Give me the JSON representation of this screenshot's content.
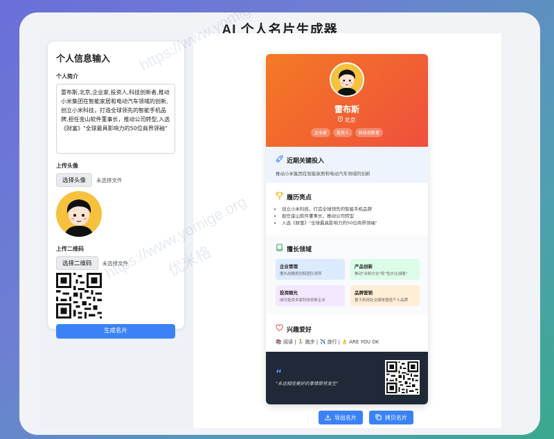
{
  "app": {
    "title": "AI 个人名片生成器"
  },
  "form": {
    "title": "个人信息输入",
    "bio_label": "个人简介",
    "bio_value": "雷布斯,北京,企业家,投资人,科技创新者,推动小米集团在智能家居和电动汽车领域的创新,创立小米科技，打造全球领先的智能手机品牌,担任金山软件董事长，推动公司转型,入选《财富》\"全球最具影响力的50位商界领袖\"",
    "avatar_label": "上传头像",
    "avatar_button": "选择头像",
    "avatar_status": "未选择文件",
    "qr_label": "上传二维码",
    "qr_button": "选择二维码",
    "qr_status": "未选择文件",
    "generate_button": "生成名片"
  },
  "card": {
    "name": "雷布斯",
    "location": "北京",
    "tags": [
      "企业家",
      "投资人",
      "科技创新者"
    ],
    "focus": {
      "title": "近期关键投入",
      "text": "推动小米集团在智能家居和电动汽车领域的创新"
    },
    "highlights": {
      "title": "履历亮点",
      "items": [
        "创立小米科技，打造全球领先的智能手机品牌",
        "担任金山软件董事长，推动公司转型",
        "入选《财富》\"全球最具影响力的50位商界领袖\""
      ]
    },
    "skills": {
      "title": "擅长领域",
      "items": [
        {
          "title": "企业管理",
          "desc": "擅长战略规划和团队领导",
          "color": "#dbeafe"
        },
        {
          "title": "产品创新",
          "desc": "推动\"米粉文化\"和\"性价比战略\"",
          "color": "#dcfce7"
        },
        {
          "title": "投资眼光",
          "desc": "成功投资多家科技创新企业",
          "color": "#f3e8ff"
        },
        {
          "title": "品牌营销",
          "desc": "善于利用社交媒体塑造个人品牌",
          "color": "#ffedd5"
        }
      ]
    },
    "hobbies": {
      "title": "兴趣爱好",
      "text": "📚 阅读 | 🏃 跑步 | ✈️ 旅行 | 👌 ARE YOU OK"
    },
    "quote": "\"永远相信美好的事情即将发生\""
  },
  "actions": {
    "export": "导出名片",
    "copy": "拷贝名片"
  },
  "watermark": {
    "url": "https://www.yomige.org",
    "text": "优米格"
  },
  "colors": {
    "accent": "#3b82f6",
    "card_gradient_start": "#f47a24",
    "card_gradient_end": "#ef4f3d",
    "footer": "#1f2937"
  }
}
